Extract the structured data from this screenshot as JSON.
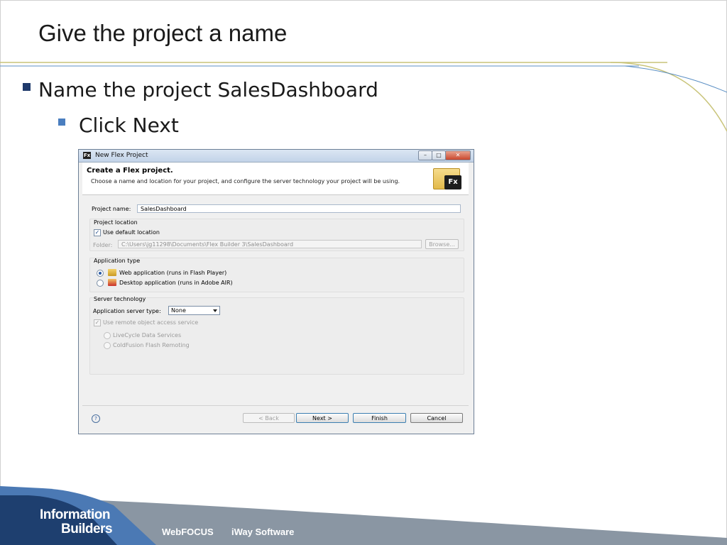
{
  "slide": {
    "title": "Give the project a name",
    "bullets": [
      {
        "text": "Name the project SalesDashboard",
        "level": 1
      },
      {
        "text": "Click Next",
        "level": 2
      }
    ]
  },
  "dialog": {
    "window_title": "New Flex Project",
    "window_icon": "Fx",
    "window_buttons": {
      "minimize": "–",
      "maximize": "□",
      "close": "✕"
    },
    "header_title": "Create a Flex project.",
    "header_desc": "Choose a name and location for your project, and configure the server technology your project will be using.",
    "header_icon_text": "Fx",
    "project_name_label": "Project name:",
    "project_name_value": "SalesDashboard",
    "location": {
      "group_label": "Project location",
      "use_default_label": "Use default location",
      "use_default_checked": true,
      "folder_label": "Folder:",
      "folder_value": "C:\\Users\\jg11298\\Documents\\Flex Builder 3\\SalesDashboard",
      "browse_label": "Browse..."
    },
    "app_type": {
      "group_label": "Application type",
      "web_label": "Web application (runs in Flash Player)",
      "desktop_label": "Desktop application (runs in Adobe AIR)",
      "selected": "web"
    },
    "server": {
      "group_label": "Server technology",
      "type_label": "Application server type:",
      "type_value": "None",
      "remote_label": "Use remote object access service",
      "remote_checked": true,
      "livecycle_label": "LiveCycle Data Services",
      "coldfusion_label": "ColdFusion Flash Remoting"
    },
    "buttons": {
      "help": "?",
      "back": "< Back",
      "next": "Next >",
      "finish": "Finish",
      "cancel": "Cancel"
    }
  },
  "footer": {
    "brand_line1": "Information",
    "brand_line2": "Builders",
    "product1": "WebFOCUS",
    "product2": "iWay Software"
  },
  "colors": {
    "footer_dark": "#1e3f6f",
    "footer_mid": "#4b79b4",
    "footer_gray": "#8a96a3",
    "accent_line": "#c9c47a",
    "accent_blue_line": "#5b8fc4"
  }
}
